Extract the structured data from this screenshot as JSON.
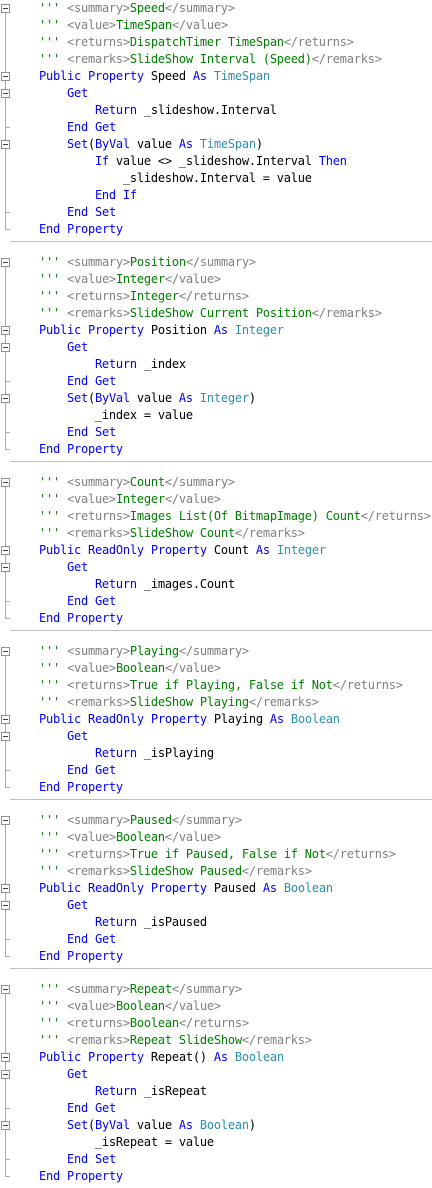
{
  "editor": {
    "language": "Visual Basic",
    "colors": {
      "keyword": "#0000ff",
      "type": "#2b91af",
      "comment": "#008000",
      "xml_doc_tag": "#808080",
      "plain": "#000000",
      "background": "#ffffff",
      "separator": "#c0c0c0"
    },
    "properties": [
      {
        "name": "Speed",
        "lines": [
          {
            "text": "    ''' <summary>Speed</summary>",
            "kind": "doc"
          },
          {
            "text": "    ''' <value>TimeSpan</value>",
            "kind": "doc"
          },
          {
            "text": "    ''' <returns>DispatchTimer TimeSpan</returns>",
            "kind": "doc"
          },
          {
            "text": "    ''' <remarks>SlideShow Interval (Speed)</remarks>",
            "kind": "doc"
          },
          {
            "text": "    Public Property Speed As TimeSpan",
            "kind": "code"
          },
          {
            "text": "        Get",
            "kind": "code"
          },
          {
            "text": "            Return _slideshow.Interval",
            "kind": "code"
          },
          {
            "text": "        End Get",
            "kind": "code"
          },
          {
            "text": "        Set(ByVal value As TimeSpan)",
            "kind": "code"
          },
          {
            "text": "            If value <> _slideshow.Interval Then",
            "kind": "code"
          },
          {
            "text": "                _slideshow.Interval = value",
            "kind": "code"
          },
          {
            "text": "            End If",
            "kind": "code"
          },
          {
            "text": "        End Set",
            "kind": "code"
          },
          {
            "text": "    End Property",
            "kind": "code"
          }
        ]
      },
      {
        "name": "Position",
        "lines": [
          {
            "text": "    ''' <summary>Position</summary>",
            "kind": "doc"
          },
          {
            "text": "    ''' <value>Integer</value>",
            "kind": "doc"
          },
          {
            "text": "    ''' <returns>Integer</returns>",
            "kind": "doc"
          },
          {
            "text": "    ''' <remarks>SlideShow Current Position</remarks>",
            "kind": "doc"
          },
          {
            "text": "    Public Property Position As Integer",
            "kind": "code"
          },
          {
            "text": "        Get",
            "kind": "code"
          },
          {
            "text": "            Return _index",
            "kind": "code"
          },
          {
            "text": "        End Get",
            "kind": "code"
          },
          {
            "text": "        Set(ByVal value As Integer)",
            "kind": "code"
          },
          {
            "text": "            _index = value",
            "kind": "code"
          },
          {
            "text": "        End Set",
            "kind": "code"
          },
          {
            "text": "    End Property",
            "kind": "code"
          }
        ]
      },
      {
        "name": "Count",
        "lines": [
          {
            "text": "    ''' <summary>Count</summary>",
            "kind": "doc"
          },
          {
            "text": "    ''' <value>Integer</value>",
            "kind": "doc"
          },
          {
            "text": "    ''' <returns>Images List(Of BitmapImage) Count</returns>",
            "kind": "doc"
          },
          {
            "text": "    ''' <remarks>SlideShow Count</remarks>",
            "kind": "doc"
          },
          {
            "text": "    Public ReadOnly Property Count As Integer",
            "kind": "code"
          },
          {
            "text": "        Get",
            "kind": "code"
          },
          {
            "text": "            Return _images.Count",
            "kind": "code"
          },
          {
            "text": "        End Get",
            "kind": "code"
          },
          {
            "text": "    End Property",
            "kind": "code"
          }
        ]
      },
      {
        "name": "Playing",
        "lines": [
          {
            "text": "    ''' <summary>Playing</summary>",
            "kind": "doc"
          },
          {
            "text": "    ''' <value>Boolean</value>",
            "kind": "doc"
          },
          {
            "text": "    ''' <returns>True if Playing, False if Not</returns>",
            "kind": "doc"
          },
          {
            "text": "    ''' <remarks>SlideShow Playing</remarks>",
            "kind": "doc"
          },
          {
            "text": "    Public ReadOnly Property Playing As Boolean",
            "kind": "code"
          },
          {
            "text": "        Get",
            "kind": "code"
          },
          {
            "text": "            Return _isPlaying",
            "kind": "code"
          },
          {
            "text": "        End Get",
            "kind": "code"
          },
          {
            "text": "    End Property",
            "kind": "code"
          }
        ]
      },
      {
        "name": "Paused",
        "lines": [
          {
            "text": "    ''' <summary>Paused</summary>",
            "kind": "doc"
          },
          {
            "text": "    ''' <value>Boolean</value>",
            "kind": "doc"
          },
          {
            "text": "    ''' <returns>True if Paused, False if Not</returns>",
            "kind": "doc"
          },
          {
            "text": "    ''' <remarks>SlideShow Paused</remarks>",
            "kind": "doc"
          },
          {
            "text": "    Public ReadOnly Property Paused As Boolean",
            "kind": "code"
          },
          {
            "text": "        Get",
            "kind": "code"
          },
          {
            "text": "            Return _isPaused",
            "kind": "code"
          },
          {
            "text": "        End Get",
            "kind": "code"
          },
          {
            "text": "    End Property",
            "kind": "code"
          }
        ]
      },
      {
        "name": "Repeat",
        "lines": [
          {
            "text": "    ''' <summary>Repeat</summary>",
            "kind": "doc"
          },
          {
            "text": "    ''' <value>Boolean</value>",
            "kind": "doc"
          },
          {
            "text": "    ''' <returns>Boolean</returns>",
            "kind": "doc"
          },
          {
            "text": "    ''' <remarks>Repeat SlideShow</remarks>",
            "kind": "doc"
          },
          {
            "text": "    Public Property Repeat() As Boolean",
            "kind": "code"
          },
          {
            "text": "        Get",
            "kind": "code"
          },
          {
            "text": "            Return _isRepeat",
            "kind": "code"
          },
          {
            "text": "        End Get",
            "kind": "code"
          },
          {
            "text": "        Set(ByVal value As Boolean)",
            "kind": "code"
          },
          {
            "text": "            _isRepeat = value",
            "kind": "code"
          },
          {
            "text": "        End Set",
            "kind": "code"
          },
          {
            "text": "    End Property",
            "kind": "code"
          }
        ]
      }
    ]
  }
}
